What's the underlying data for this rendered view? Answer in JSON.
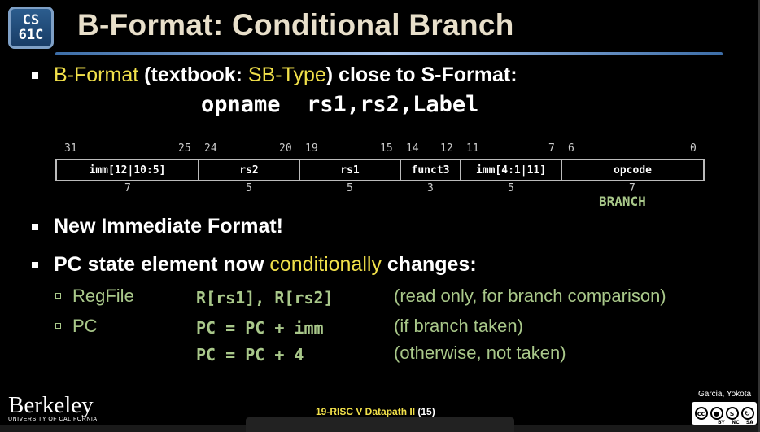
{
  "slide": {
    "logo": {
      "line1": "CS",
      "line2": "61C"
    },
    "title": "B-Format: Conditional Branch",
    "bullet1": {
      "part1": "B-Format",
      "part2": " (textbook: ",
      "part3": "SB-Type",
      "part4": ") close to S-Format:"
    },
    "syntax": "opname  rs1,rs2,Label",
    "bit_positions": [
      "31",
      "25",
      "24",
      "20",
      "19",
      "15",
      "14",
      "12",
      "11",
      "7",
      "6",
      "0"
    ],
    "fields": [
      {
        "label": "imm[12|10:5]",
        "width": "7"
      },
      {
        "label": "rs2",
        "width": "5"
      },
      {
        "label": "rs1",
        "width": "5"
      },
      {
        "label": "funct3",
        "width": "3"
      },
      {
        "label": "imm[4:1|11]",
        "width": "5"
      },
      {
        "label": "opcode",
        "width": "7"
      }
    ],
    "opcode_value": "BRANCH",
    "bullet2": "New Immediate Format!",
    "bullet3": {
      "part1": "PC state element now ",
      "part2": "conditionally",
      "part3": " changes:"
    },
    "rows": [
      {
        "label": "RegFile",
        "code": "R[rs1], R[rs2]",
        "note": "(read only, for branch comparison)"
      },
      {
        "label": "PC",
        "code": "PC = PC + imm",
        "note": "(if branch taken)"
      },
      {
        "label": "",
        "code": "PC = PC + 4",
        "note": "(otherwise, not taken)"
      }
    ],
    "footer": {
      "lecture": "19-RISC V Datapath II",
      "page": "(15)"
    },
    "authors": "Garcia, Yokota",
    "institution": {
      "name": "Berkeley",
      "sub": "UNIVERSITY OF CALIFORNIA"
    },
    "license": {
      "icons": [
        "cc-icon",
        "by-icon",
        "nc-icon",
        "sa-icon"
      ],
      "labels": [
        "BY",
        "NC",
        "SA"
      ]
    }
  }
}
